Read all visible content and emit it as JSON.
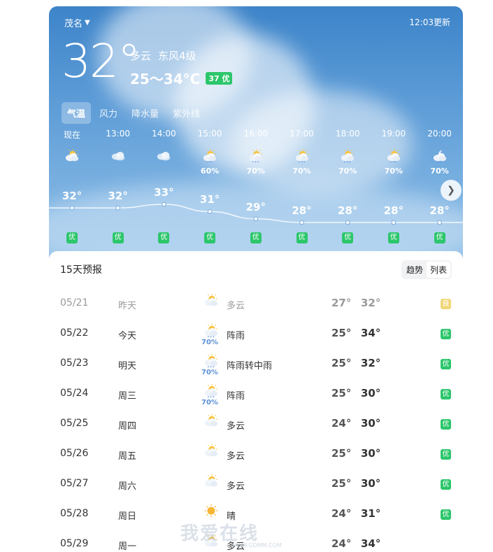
{
  "header": {
    "location": "茂名",
    "update_time": "12:03更新",
    "current_temp": "32°",
    "condition": "多云",
    "wind": "东风4级",
    "range": "25～34°C",
    "aqi": "37 优"
  },
  "tabs": [
    {
      "label": "气温",
      "active": true
    },
    {
      "label": "风力",
      "active": false
    },
    {
      "label": "降水量",
      "active": false
    },
    {
      "label": "紫外线",
      "active": false
    }
  ],
  "hourly": [
    {
      "time": "现在",
      "icon": "partly-cloudy-icon",
      "pct": "",
      "temp": "32°",
      "t": 32,
      "aq": "优"
    },
    {
      "time": "13:00",
      "icon": "cloudy-icon",
      "pct": "",
      "temp": "32°",
      "t": 32,
      "aq": "优"
    },
    {
      "time": "14:00",
      "icon": "cloudy-icon",
      "pct": "",
      "temp": "33°",
      "t": 33,
      "aq": "优"
    },
    {
      "time": "15:00",
      "icon": "shower-icon",
      "pct": "60%",
      "temp": "31°",
      "t": 31,
      "aq": "优"
    },
    {
      "time": "16:00",
      "icon": "shower-icon",
      "pct": "70%",
      "temp": "29°",
      "t": 29,
      "aq": "优"
    },
    {
      "time": "17:00",
      "icon": "shower-icon",
      "pct": "70%",
      "temp": "28°",
      "t": 28,
      "aq": "优"
    },
    {
      "time": "18:00",
      "icon": "shower-icon",
      "pct": "70%",
      "temp": "28°",
      "t": 28,
      "aq": "优"
    },
    {
      "time": "19:00",
      "icon": "shower-icon",
      "pct": "70%",
      "temp": "28°",
      "t": 28,
      "aq": "优"
    },
    {
      "time": "20:00",
      "icon": "night-shower-icon",
      "pct": "70%",
      "temp": "28°",
      "t": 28,
      "aq": "优"
    }
  ],
  "forecast": {
    "title": "15天预报",
    "toggle": [
      "趋势",
      "列表"
    ],
    "rows": [
      {
        "date": "05/21",
        "day": "昨天",
        "icon": "partly-cloudy-icon",
        "pct": "",
        "cond": "多云",
        "lo": "27°",
        "hi": "32°",
        "aq": "良",
        "past": true
      },
      {
        "date": "05/22",
        "day": "今天",
        "icon": "shower-icon",
        "pct": "70%",
        "cond": "阵雨",
        "lo": "25°",
        "hi": "34°",
        "aq": "优",
        "past": false
      },
      {
        "date": "05/23",
        "day": "明天",
        "icon": "shower-icon",
        "pct": "70%",
        "cond": "阵雨转中雨",
        "lo": "25°",
        "hi": "32°",
        "aq": "优",
        "past": false
      },
      {
        "date": "05/24",
        "day": "周三",
        "icon": "shower-icon",
        "pct": "70%",
        "cond": "阵雨",
        "lo": "25°",
        "hi": "30°",
        "aq": "优",
        "past": false
      },
      {
        "date": "05/25",
        "day": "周四",
        "icon": "partly-cloudy-icon",
        "pct": "",
        "cond": "多云",
        "lo": "24°",
        "hi": "30°",
        "aq": "优",
        "past": false
      },
      {
        "date": "05/26",
        "day": "周五",
        "icon": "partly-cloudy-icon",
        "pct": "",
        "cond": "多云",
        "lo": "25°",
        "hi": "30°",
        "aq": "优",
        "past": false
      },
      {
        "date": "05/27",
        "day": "周六",
        "icon": "partly-cloudy-icon",
        "pct": "",
        "cond": "多云",
        "lo": "25°",
        "hi": "30°",
        "aq": "优",
        "past": false
      },
      {
        "date": "05/28",
        "day": "周日",
        "icon": "sunny-icon",
        "pct": "",
        "cond": "晴",
        "lo": "24°",
        "hi": "31°",
        "aq": "优",
        "past": false
      },
      {
        "date": "05/29",
        "day": "周一",
        "icon": "partly-cloudy-icon",
        "pct": "",
        "cond": "多云",
        "lo": "24°",
        "hi": "34°",
        "aq": "",
        "past": false
      }
    ]
  },
  "watermark": {
    "text": "我爱在线",
    "url": "WWW.GDMM.COM"
  },
  "colors": {
    "sky_top": "#3d84c9",
    "good": "#2cc66b",
    "fair": "#f1d77a",
    "rain_pct": "#5b8fd8"
  }
}
